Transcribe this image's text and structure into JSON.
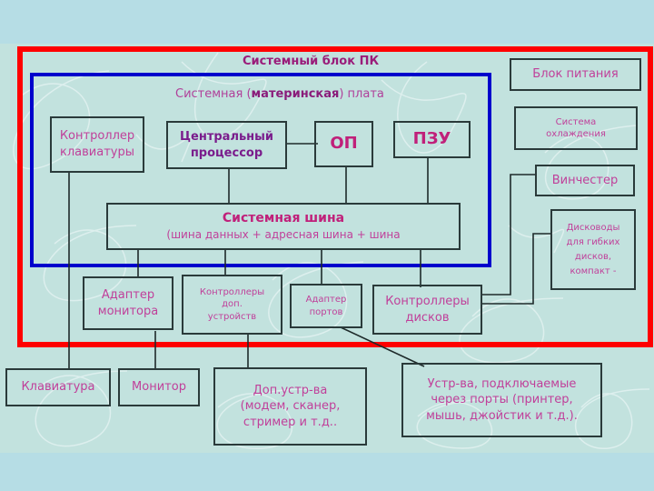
{
  "diagram": {
    "system_unit_title": "Системный блок ПК",
    "motherboard_label": {
      "prefix": "Системная (",
      "bold": "материнская",
      "suffix": ") плата"
    },
    "blocks": {
      "keyboard_controller": [
        "Контроллер",
        "клавиатуры"
      ],
      "cpu": [
        "Центральный",
        "процессор"
      ],
      "ram": "ОП",
      "rom": "ПЗУ",
      "power_supply": "Блок питания",
      "cooling": [
        "Система",
        "охлаждения"
      ],
      "hdd": "Винчестер",
      "drives": [
        "Дисководы",
        "для гибких",
        "дисков,",
        "компакт -"
      ],
      "system_bus_title": "Системная шина",
      "system_bus_sub": "(шина данных + адресная шина + шина",
      "monitor_adapter": [
        "Адаптер",
        "монитора"
      ],
      "extra_controllers": [
        "Контроллеры",
        "доп.",
        "устройств"
      ],
      "port_adapter": [
        "Адаптер",
        "портов"
      ],
      "disk_controllers": [
        "Контроллеры",
        "дисков"
      ],
      "keyboard": "Клавиатура",
      "monitor": "Монитор",
      "extra_devices": [
        "Доп.устр-ва",
        "(модем,  сканер,",
        "стример и т.д.."
      ],
      "port_devices": [
        "Устр-ва, подключаемые",
        "через порты (принтер,",
        "мышь, джойстик и т.д.)."
      ]
    },
    "colors": {
      "outer_frame": "#ff0000",
      "motherboard_frame": "#0000cc",
      "text": "#c0409a",
      "emphasis_text": "#7a1c8c"
    }
  }
}
